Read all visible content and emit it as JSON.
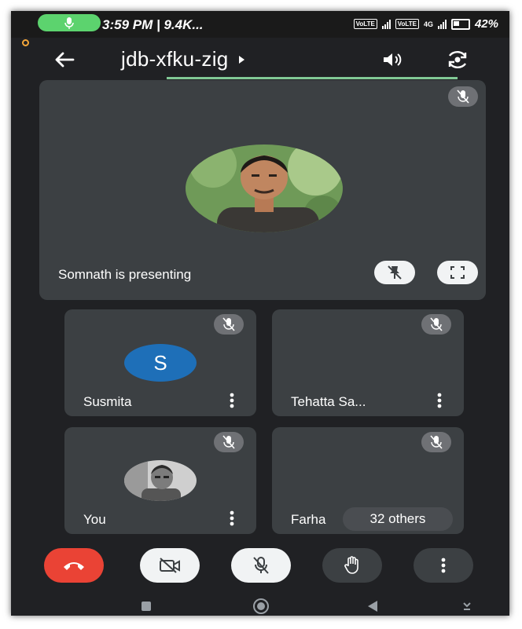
{
  "status_bar": {
    "time": "3:59 PM | 9.4K...",
    "network_badge_1": "VoLTE",
    "network_badge_2": "VoLTE",
    "net_type": "4G",
    "battery": "42%"
  },
  "header": {
    "meeting_code": "jdb-xfku-zig",
    "back_icon": "arrow-left-icon",
    "speaker_icon": "speaker-icon",
    "switch_camera_icon": "switch-camera-icon"
  },
  "presenter": {
    "label": "Somnath is presenting",
    "pin_icon": "unpin-icon",
    "fullscreen_icon": "fullscreen-icon"
  },
  "participants": [
    {
      "name": "Susmita",
      "avatar_letter": "S",
      "avatar_color": "#1e6fb8"
    },
    {
      "name": "Tehatta Sa..."
    },
    {
      "name": "You"
    },
    {
      "name": "Farha",
      "others": "32 others"
    }
  ],
  "controls": {
    "end_call_color": "#ea4335",
    "items": [
      "end-call",
      "camera-off",
      "mic-off",
      "raise-hand",
      "more-options"
    ]
  },
  "colors": {
    "background": "#202124",
    "tile": "#3c4043",
    "accent_green": "#81c995"
  }
}
